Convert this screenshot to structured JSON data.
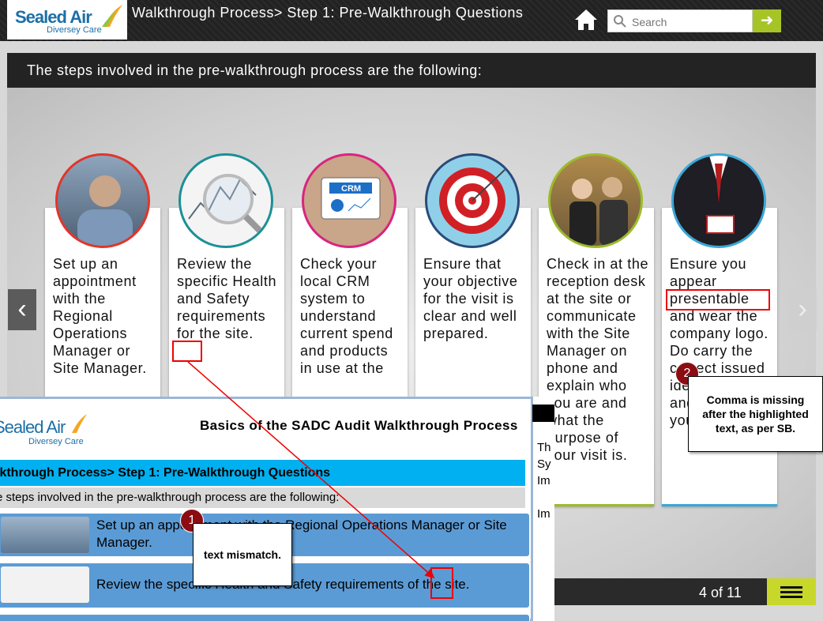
{
  "header": {
    "logo_main": "Sealed Air",
    "logo_sub": "Diversey Care",
    "title": "Walkthrough Process> Step 1: Pre-Walkthrough Questions",
    "search_placeholder": "Search"
  },
  "banner": "The steps involved in the pre-walkthrough process are the following:",
  "cards": [
    {
      "text": "Set up an appointment with the Regional Operations Manager or Site Manager.",
      "ring": "#e2352b"
    },
    {
      "text": "Review the specific Health and Safety requirements for the site.",
      "ring": "#1c8f97"
    },
    {
      "text": "Check your local CRM system to understand current spend and products in use at the",
      "ring": "#d9247f"
    },
    {
      "text": "Ensure that your objective for the visit is clear and well prepared.",
      "ring": "#2a4a7a"
    },
    {
      "text": "Check in at the reception desk at the site or communicate with the Site Manager on phone and explain who you are and what the purpose of your visit is.",
      "ring": "#9cbb2b"
    },
    {
      "text": "Ensure you appear presentable and wear the company logo. Do carry the correct issued identity badge and smile on your face!",
      "ring": "#3aa6d6"
    }
  ],
  "annotations": {
    "a1": {
      "num": "1",
      "text": "text mismatch."
    },
    "a2": {
      "num": "2",
      "text": "Comma is missing after the highlighted text, as per SB."
    }
  },
  "panel": {
    "logo_main": "Sealed Air",
    "logo_sub": "Diversey Care",
    "title": "Basics of the SADC Audit Walkthrough Process",
    "step_title": "lkthrough Process> Step 1: Pre-Walkthrough Questions",
    "intro": "e steps involved in the pre-walkthrough process are the following:",
    "row1": "Set up an appointment with the Regional Operations Manager or Site Manager.",
    "row2": "Review the specific Health and Safety requirements of the site.",
    "side": [
      "Th",
      "Sy",
      "Im",
      "Im"
    ]
  },
  "pager": "4 of 11"
}
